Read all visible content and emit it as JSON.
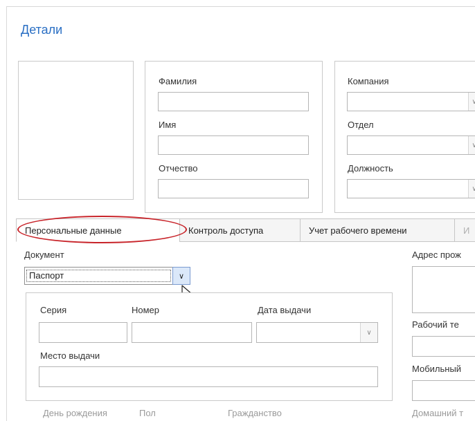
{
  "page": {
    "title": "Детали"
  },
  "name_fields": {
    "last_name_label": "Фамилия",
    "first_name_label": "Имя",
    "middle_name_label": "Отчество"
  },
  "org_fields": {
    "company_label": "Компания",
    "department_label": "Отдел",
    "position_label": "Должность"
  },
  "tabs": [
    {
      "label": "Персональные данные",
      "active": true
    },
    {
      "label": "Контроль доступа",
      "active": false
    },
    {
      "label": "Учет рабочего времени",
      "active": false
    },
    {
      "label": "И",
      "active": false
    }
  ],
  "personal": {
    "document_label": "Документ",
    "document_value": "Паспорт",
    "series_label": "Серия",
    "number_label": "Номер",
    "issue_date_label": "Дата выдачи",
    "issue_place_label": "Место выдачи",
    "birthday_label": "День рождения",
    "gender_label": "Пол",
    "citizenship_label": "Гражданство"
  },
  "contacts": {
    "address_label": "Адрес прож",
    "work_phone_label": "Рабочий те",
    "mobile_label": "Мобильный",
    "home_label": "Домашний т"
  },
  "colors": {
    "title": "#2a6fc4",
    "highlight_ellipse": "#c8242a"
  }
}
